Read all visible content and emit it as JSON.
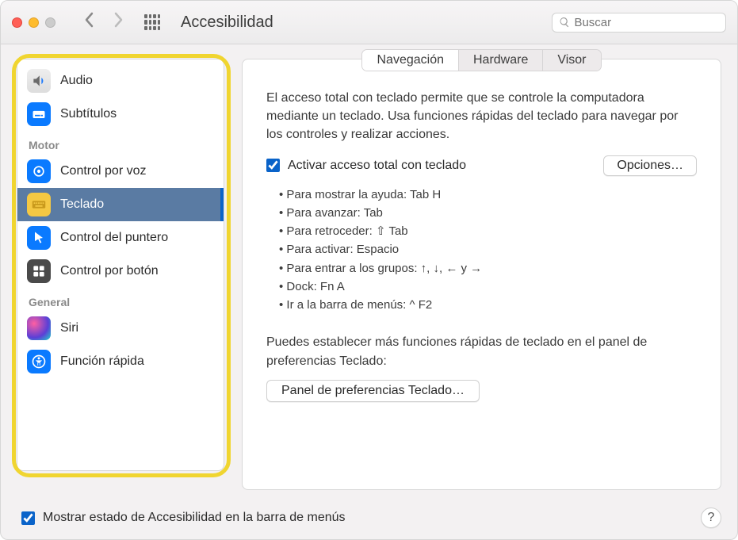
{
  "window": {
    "title": "Accesibilidad"
  },
  "search": {
    "placeholder": "Buscar"
  },
  "sidebar": {
    "items": [
      {
        "label": "Audio"
      },
      {
        "label": "Subtítulos"
      }
    ],
    "group_motor": "Motor",
    "motor": [
      {
        "label": "Control por voz"
      },
      {
        "label": "Teclado"
      },
      {
        "label": "Control del puntero"
      },
      {
        "label": "Control por botón"
      }
    ],
    "group_general": "General",
    "general": [
      {
        "label": "Siri"
      },
      {
        "label": "Función rápida"
      }
    ]
  },
  "tabs": {
    "navegacion": "Navegación",
    "hardware": "Hardware",
    "visor": "Visor"
  },
  "pane": {
    "description": "El acceso total con teclado permite que se controle la computadora mediante un teclado. Usa funciones rápidas del teclado para navegar por los controles y realizar acciones.",
    "enable_label": "Activar acceso total con teclado",
    "options_btn": "Opciones…",
    "hints": [
      "Para mostrar la ayuda: Tab H",
      "Para avanzar: Tab",
      "Para retroceder: ⇧ Tab",
      "Para activar: Espacio",
      "Para entrar a los grupos: ↑, ↓, ← y →",
      "Dock: Fn A",
      "Ir a la barra de menús: ^ F2"
    ],
    "more": "Puedes establecer más funciones rápidas de teclado en el panel de preferencias Teclado:",
    "kb_prefs_btn": "Panel de preferencias Teclado…"
  },
  "footer": {
    "show_status": "Mostrar estado de Accesibilidad en la barra de menús"
  }
}
